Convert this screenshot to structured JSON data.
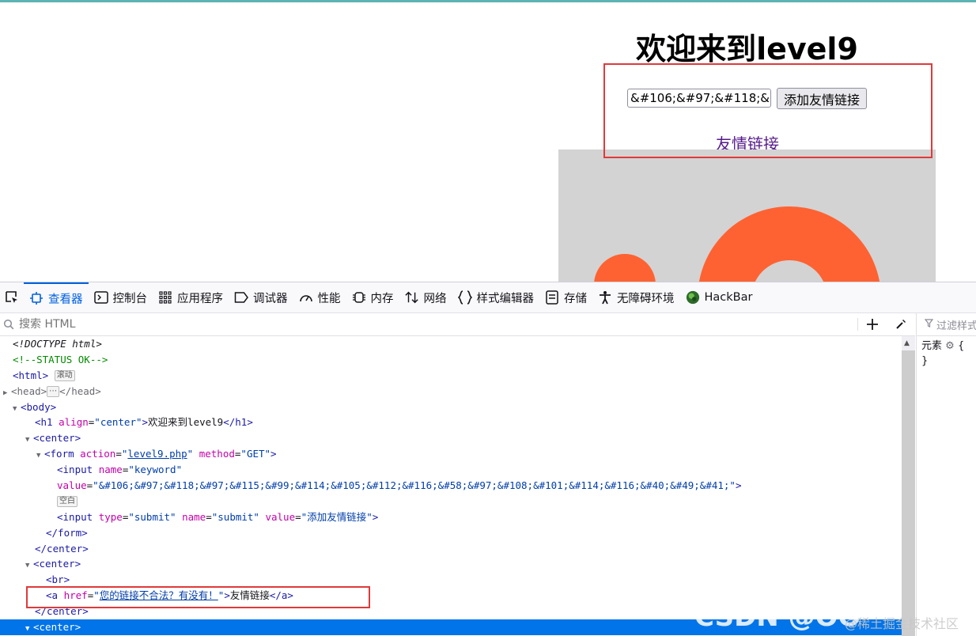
{
  "page": {
    "title": "欢迎来到level9",
    "keyword_value": "&#106;&#97;&#118;&#97;&#115;&#99;&#114;&#105;&#112;&#116;&#58;&#97;&#108;&#101;&#114;&#116;&#40;&#49;&#41;",
    "submit_label": "添加友情链接",
    "friend_link": "友情链接"
  },
  "devtools": {
    "tabs": [
      {
        "label": "查看器",
        "icon": "inspector-icon",
        "active": true
      },
      {
        "label": "控制台",
        "icon": "console-icon"
      },
      {
        "label": "应用程序",
        "icon": "application-icon"
      },
      {
        "label": "调试器",
        "icon": "debugger-icon"
      },
      {
        "label": "性能",
        "icon": "performance-icon"
      },
      {
        "label": "内存",
        "icon": "memory-icon"
      },
      {
        "label": "网络",
        "icon": "network-icon"
      },
      {
        "label": "样式编辑器",
        "icon": "style-editor-icon"
      },
      {
        "label": "存储",
        "icon": "storage-icon"
      },
      {
        "label": "无障碍环境",
        "icon": "accessibility-icon"
      },
      {
        "label": "HackBar",
        "icon": "hackbar-icon"
      }
    ],
    "search_placeholder": "搜索 HTML",
    "filter_placeholder": "过滤样式",
    "rules": {
      "element_label": "元素",
      "open_brace": "{",
      "close_brace": "}"
    },
    "markup": {
      "doctype": "<!DOCTYPE html>",
      "comment": "<!--STATUS OK-->",
      "html_open": "<html>",
      "scroll_badge": "滚动",
      "head_open": "<head>",
      "ellipsis_badge": "⋯",
      "head_close": "</head>",
      "body_open": "<body>",
      "h1_tag": "h1",
      "h1_attr": "align",
      "h1_attr_val": "center",
      "h1_text": "欢迎来到level9",
      "center_open": "<center>",
      "form_tag": "form",
      "form_action_attr": "action",
      "form_action_val": "level9.php",
      "form_method_attr": "method",
      "form_method_val": "GET",
      "input_tag": "input",
      "input_name_attr": "name",
      "input_name_val": "keyword",
      "input_value_attr": "value",
      "input_value_val": "&#106;&#97;&#118;&#97;&#115;&#99;&#114;&#105;&#112;&#116;&#58;&#97;&#108;&#101;&#114;&#116;&#40;&#49;&#41;",
      "whitespace_badge": "空白",
      "submit_type_attr": "type",
      "submit_type_val": "submit",
      "submit_name_attr": "name",
      "submit_name_val": "submit",
      "submit_value_attr": "value",
      "submit_value_val": "添加友情链接",
      "form_close": "</form>",
      "center_close": "</center>",
      "br_tag": "<br>",
      "a_tag": "a",
      "a_href_attr": "href",
      "a_href_val": "您的链接不合法？有没有！",
      "a_text": "友情链接",
      "a_close": "</a>"
    }
  },
  "watermark": {
    "text1": "CSDN @OO",
    "text2": "@稀土掘金技术社区"
  },
  "colors": {
    "accent": "#0074e8",
    "highlight_box": "#e03a3a",
    "image_orange": "#ff6232",
    "image_bg": "#d3d3d3"
  }
}
